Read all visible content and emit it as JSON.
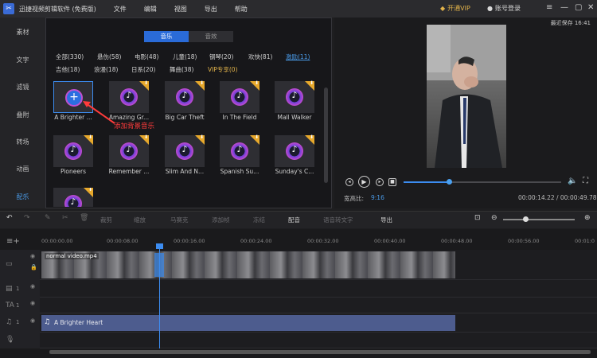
{
  "app": {
    "title": "迅捷视频剪辑软件 (免费版)",
    "menu": [
      "文件",
      "编辑",
      "视图",
      "导出",
      "帮助"
    ],
    "vip_label": "开通VIP",
    "login_label": "账号登录",
    "last_saved": "最近保存 16:41"
  },
  "sidebar": {
    "items": [
      "素材",
      "文字",
      "滤镜",
      "叠附",
      "转场",
      "动画",
      "配乐"
    ],
    "active": "配乐"
  },
  "library": {
    "tabs": [
      "音乐",
      "音效"
    ],
    "categories": [
      "全部(330)",
      "悬伤(58)",
      "电影(48)",
      "儿童(18)",
      "钢琴(20)",
      "欢快(81)",
      "激励(11)",
      "吉他(18)",
      "浪漫(18)",
      "日系(20)",
      "舞曲(38)",
      "VIP专享(0)"
    ],
    "tracks": [
      "A Brighter ...",
      "Amazing Gr...",
      "Big Car Theft",
      "In The Field",
      "Mall Walker",
      "Pioneers",
      "Remember ...",
      "Slim And N...",
      "Spanish Su...",
      "Sunday's C..."
    ],
    "annotation": "添加背景音乐"
  },
  "preview": {
    "ratio_label": "宽高比:",
    "ratio_value": "9:16",
    "time": "00:00:14.22 / 00:00:49.78",
    "progress": 0.29
  },
  "toolbar": {
    "labels": [
      "裁剪",
      "缩放",
      "马赛克",
      "添加帧",
      "冻结",
      "配音",
      "语音转文字",
      "导出"
    ]
  },
  "timeline": {
    "ticks": [
      "00:00:00.00",
      "00:00:08.00",
      "00:00:16.00",
      "00:00:24.00",
      "00:00:32.00",
      "00:00:40.00",
      "00:00:48.00",
      "00:00:56.00",
      "00:01:0"
    ],
    "video_clip": "normal video.mp4",
    "audio_clip": "A Brighter Heart",
    "track_numbers": [
      "1",
      "1",
      "1"
    ]
  },
  "colors": {
    "accent": "#3c8cf0",
    "vip": "#e2b34a",
    "annotation": "#ff3b3b",
    "audio_clip": "#4d5c8e"
  }
}
